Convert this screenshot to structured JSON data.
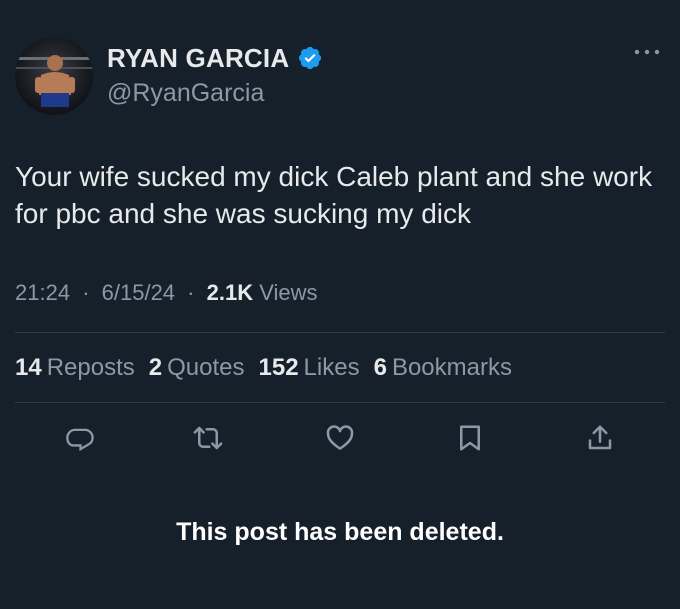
{
  "user": {
    "display_name": "RYAN GARCIA",
    "handle": "@RyanGarcia",
    "verified": true
  },
  "tweet": {
    "text": "Your wife sucked my dick Caleb plant and she work for pbc and she was sucking my dick",
    "time": "21:24",
    "date": "6/15/24",
    "separator": "·",
    "views_count": "2.1K",
    "views_label": "Views"
  },
  "stats": [
    {
      "count": "14",
      "label": "Reposts"
    },
    {
      "count": "2",
      "label": "Quotes"
    },
    {
      "count": "152",
      "label": "Likes"
    },
    {
      "count": "6",
      "label": "Bookmarks"
    }
  ],
  "actions": [
    {
      "icon": "reply-icon"
    },
    {
      "icon": "repost-icon"
    },
    {
      "icon": "like-icon"
    },
    {
      "icon": "bookmark-icon"
    },
    {
      "icon": "share-icon"
    }
  ],
  "notice": "This post has been deleted.",
  "colors": {
    "background": "#15202b",
    "text": "#e7e9ea",
    "secondary": "#8b98a5",
    "verified": "#1d9bf0",
    "divider": "#2f3b47"
  }
}
